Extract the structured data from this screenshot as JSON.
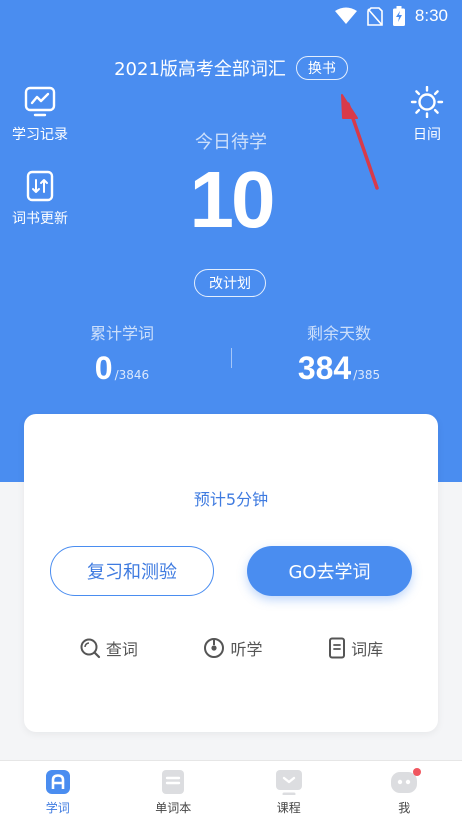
{
  "status_bar": {
    "time": "8:30",
    "icons": [
      "wifi-icon",
      "no-sim-icon",
      "battery-charging-icon"
    ]
  },
  "header": {
    "book_title": "2021版高考全部词汇",
    "change_book_label": "换书"
  },
  "left_actions": [
    {
      "label": "学习记录",
      "icon": "chart-board-icon"
    },
    {
      "label": "词书更新",
      "icon": "book-update-icon"
    }
  ],
  "right_action": {
    "label": "日间",
    "icon": "sun-icon"
  },
  "today": {
    "label": "今日待学",
    "count": "10",
    "change_plan_label": "改计划"
  },
  "stats": {
    "learned": {
      "label": "累计学词",
      "value": "0",
      "total": "/3846"
    },
    "remaining_days": {
      "label": "剩余天数",
      "value": "384",
      "total": "/385"
    }
  },
  "card": {
    "estimate": "预计5分钟",
    "review_button": "复习和测验",
    "go_button": "GO去学词",
    "tools": [
      {
        "label": "查词",
        "icon": "search-icon"
      },
      {
        "label": "听学",
        "icon": "disc-icon"
      },
      {
        "label": "词库",
        "icon": "document-icon"
      }
    ]
  },
  "tabs": [
    {
      "label": "学词",
      "icon": "learn-tab-icon",
      "active": true
    },
    {
      "label": "单词本",
      "icon": "wordbook-tab-icon",
      "active": false
    },
    {
      "label": "课程",
      "icon": "course-tab-icon",
      "active": false
    },
    {
      "label": "我",
      "icon": "profile-tab-icon",
      "active": false,
      "badge": true
    }
  ],
  "colors": {
    "primary": "#4a8df0",
    "accent_text": "#3f7be0",
    "annotation_arrow": "#d83a4a",
    "badge": "#f0565f"
  }
}
